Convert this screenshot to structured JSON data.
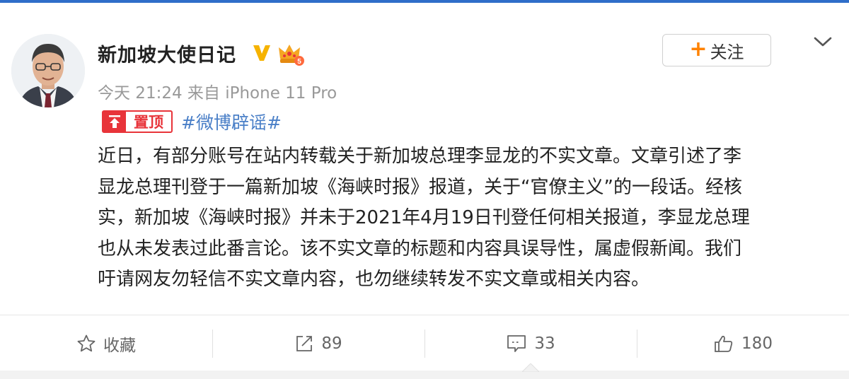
{
  "user": {
    "name": "新加坡大使日记",
    "verified_icon": "verified-v-icon",
    "level_icon": "crown-level-icon"
  },
  "post": {
    "timestamp": "今天 21:24",
    "source": "来自 iPhone 11 Pro",
    "pinned_label": "置顶",
    "hashtag": "#微博辟谣#",
    "content_lines": [
      "近日，有部分账号在站内转载关于新加坡总理李显龙的不实文章。文章引述了李",
      "显龙总理刊登于一篇新加坡《海峡时报》报道，关于“官僚主义”的一段话。经核",
      "实，新加坡《海峡时报》并未于2021年4月19日刊登任何相关报道，李显龙总理",
      "也从未发表过此番言论。该不实文章的标题和内容具误导性，属虚假新闻。我们",
      "吁请网友勿轻信不实文章内容，也勿继续转发不实文章或相关内容。"
    ]
  },
  "follow": {
    "plus": "+",
    "label": "关注"
  },
  "actions": {
    "favorite": {
      "label": "收藏",
      "icon": "star-icon"
    },
    "repost": {
      "count": "89",
      "icon": "repost-icon"
    },
    "comment": {
      "count": "33",
      "icon": "comment-icon"
    },
    "like": {
      "count": "180",
      "icon": "thumbs-up-icon"
    }
  },
  "colors": {
    "accent_orange": "#ff8200",
    "pin_red": "#e8343a",
    "link_blue": "#4a7fc7",
    "top_bar_blue": "#2f6ec9"
  }
}
